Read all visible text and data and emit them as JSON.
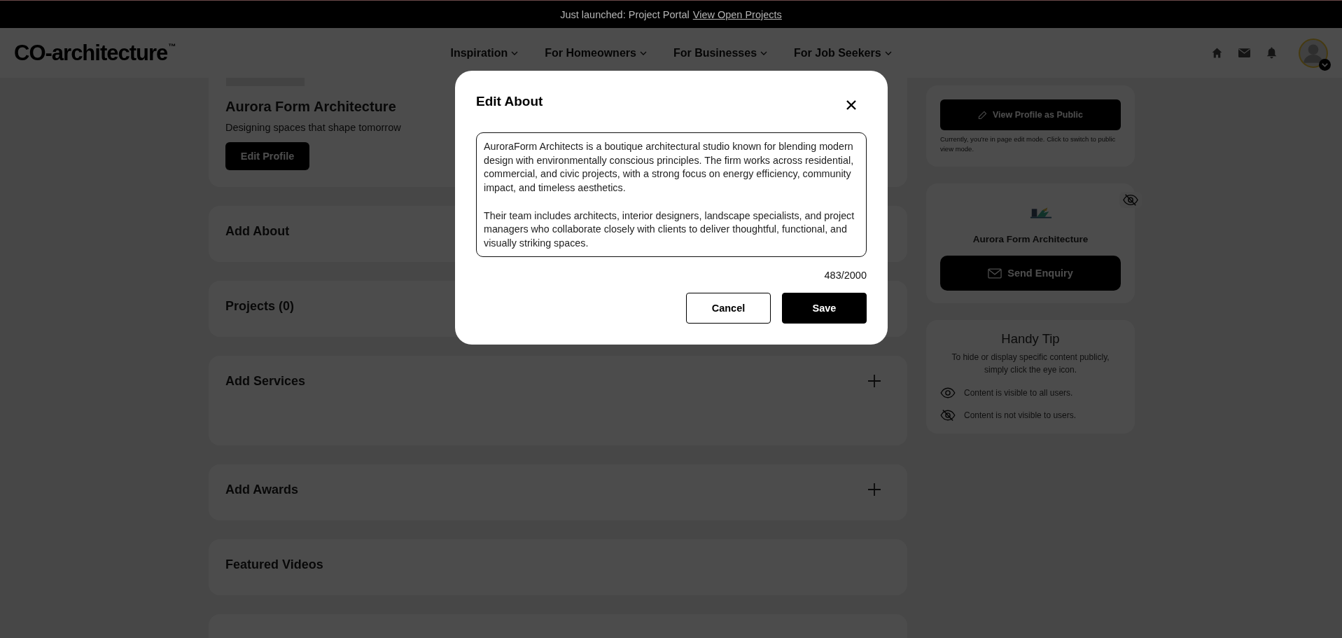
{
  "banner": {
    "text": "Just launched: Project Portal",
    "link": "View Open Projects"
  },
  "header": {
    "logo": "CO-architecture",
    "logo_mark": "™",
    "nav": [
      {
        "label": "Inspiration"
      },
      {
        "label": "For Homeowners"
      },
      {
        "label": "For Businesses"
      },
      {
        "label": "For Job Seekers"
      }
    ]
  },
  "profile": {
    "name": "Aurora Form Architecture",
    "tagline": "Designing spaces that shape tomorrow",
    "edit_button": "Edit Profile"
  },
  "sections": [
    {
      "title": "Add About",
      "tall": false
    },
    {
      "title": "Projects (0)",
      "tall": false
    },
    {
      "title": "Add Services",
      "add": true,
      "tall": true
    },
    {
      "title": "Add Awards",
      "add": true,
      "tall": false
    },
    {
      "title": "Featured Videos",
      "add": false,
      "tall": false
    }
  ],
  "sidebar": {
    "view_public": {
      "label": "View Profile as Public",
      "note": "Currently, you're in page edit mode. Click to switch to public view mode."
    },
    "company": {
      "name": "Aurora Form Architecture",
      "visible": false,
      "enquiry_button": "Send Enquiry"
    },
    "tip": {
      "title": "Handy Tip",
      "text": "To hide or display specific content publicly, simply click the eye icon.",
      "legend": [
        {
          "visible": true,
          "text": "Content is visible to all users."
        },
        {
          "visible": false,
          "text": "Content is not visible to users."
        }
      ]
    }
  },
  "modal": {
    "title": "Edit About",
    "about": "AuroraForm Architects is a boutique architectural studio known for blending modern design with environmentally conscious principles. The firm works across residential, commercial, and civic projects, with a strong focus on energy efficiency, community impact, and timeless aesthetics.\n\nTheir team includes architects, interior designers, landscape specialists, and project managers who collaborate closely with clients to deliver thoughtful, functional, and visually striking spaces.",
    "counter": "483/2000",
    "buttons": [
      {
        "label": "Cancel",
        "kind": "secondary"
      },
      {
        "label": "Save",
        "kind": "primary"
      }
    ]
  }
}
